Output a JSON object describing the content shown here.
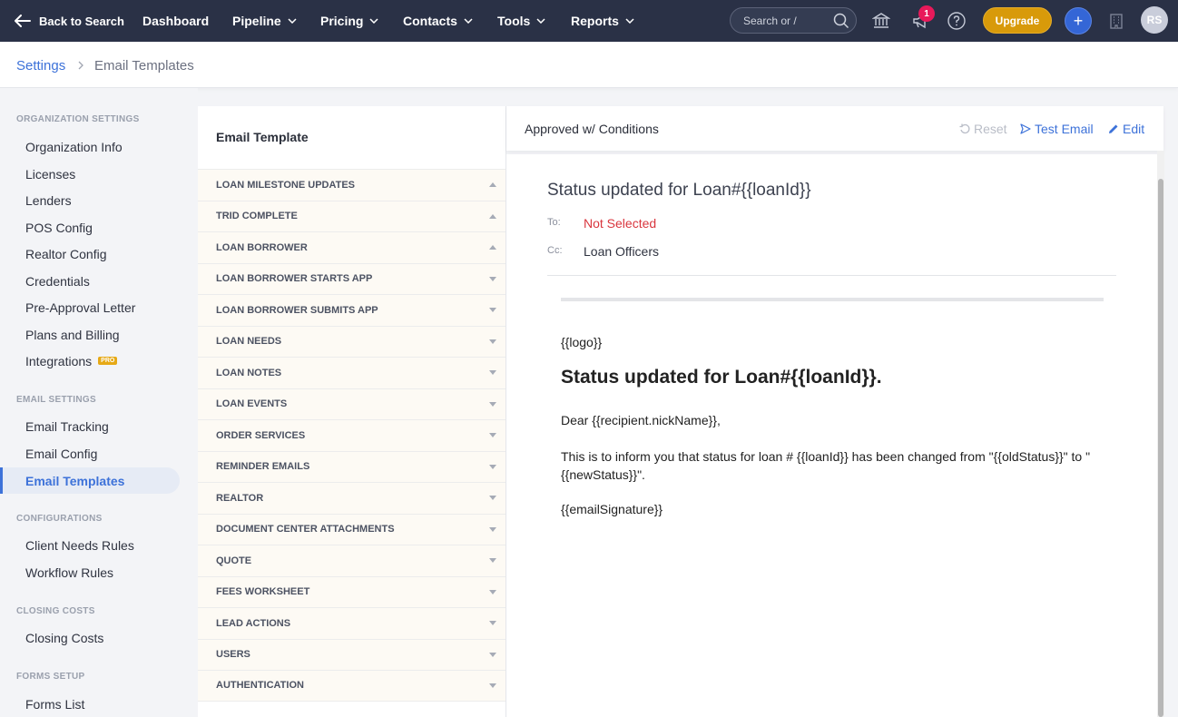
{
  "nav": {
    "back_label": "Back to Search",
    "items": [
      "Dashboard",
      "Pipeline",
      "Pricing",
      "Contacts",
      "Tools",
      "Reports"
    ],
    "search_placeholder": "Search or /",
    "notification_count": "1",
    "upgrade_label": "Upgrade",
    "plus_label": "+",
    "avatar_initials": "RS"
  },
  "breadcrumb": {
    "root": "Settings",
    "current": "Email Templates"
  },
  "sidebar": {
    "org_heading": "ORGANIZATION SETTINGS",
    "org_items": [
      "Organization Info",
      "Licenses",
      "Lenders",
      "POS Config",
      "Realtor Config",
      "Credentials",
      "Pre-Approval Letter",
      "Plans and Billing",
      "Integrations"
    ],
    "pro_badge": "PRO",
    "email_heading": "EMAIL SETTINGS",
    "email_items": [
      "Email Tracking",
      "Email Config",
      "Email Templates"
    ],
    "config_heading": "CONFIGURATIONS",
    "config_items": [
      "Client Needs Rules",
      "Workflow Rules"
    ],
    "closing_heading": "CLOSING COSTS",
    "closing_items": [
      "Closing Costs"
    ],
    "forms_heading": "FORMS SETUP",
    "forms_items": [
      "Forms List"
    ]
  },
  "templates": {
    "title": "Email Template",
    "groups": [
      {
        "label": "LOAN MILESTONE UPDATES",
        "expanded": true
      },
      {
        "label": "TRID COMPLETE",
        "expanded": true
      },
      {
        "label": "LOAN BORROWER",
        "expanded": true
      },
      {
        "label": "LOAN BORROWER STARTS APP",
        "expanded": false
      },
      {
        "label": "LOAN BORROWER SUBMITS APP",
        "expanded": false
      },
      {
        "label": "LOAN NEEDS",
        "expanded": false
      },
      {
        "label": "LOAN NOTES",
        "expanded": false
      },
      {
        "label": "LOAN EVENTS",
        "expanded": false
      },
      {
        "label": "ORDER SERVICES",
        "expanded": false
      },
      {
        "label": "REMINDER EMAILS",
        "expanded": false
      },
      {
        "label": "REALTOR",
        "expanded": false
      },
      {
        "label": "DOCUMENT CENTER ATTACHMENTS",
        "expanded": false
      },
      {
        "label": "QUOTE",
        "expanded": false
      },
      {
        "label": "FEES WORKSHEET",
        "expanded": false
      },
      {
        "label": "LEAD ACTIONS",
        "expanded": false
      },
      {
        "label": "USERS",
        "expanded": false
      },
      {
        "label": "AUTHENTICATION",
        "expanded": false
      }
    ]
  },
  "detail": {
    "title": "Approved w/ Conditions",
    "reset_label": "Reset",
    "test_email_label": "Test Email",
    "edit_label": "Edit",
    "subject": "Status updated for Loan#{{loanId}}",
    "to_label": "To:",
    "to_value": "Not Selected",
    "cc_label": "Cc:",
    "cc_value": "Loan Officers",
    "body": {
      "logo": "{{logo}}",
      "heading": "Status updated for Loan#{{loanId}}.",
      "greeting": "Dear {{recipient.nickName}},",
      "line1": "This is to inform you that status for loan # {{loanId}} has been changed from \"{{oldStatus}}\" to \"",
      "line2": "{{newStatus}}\".",
      "signature": "{{emailSignature}}"
    }
  },
  "colors": {
    "nav_bg": "#2a3146",
    "accent": "#3d72d9",
    "upgrade": "#d89a0a",
    "badge": "#e8195a",
    "not_selected": "#d9363e"
  }
}
